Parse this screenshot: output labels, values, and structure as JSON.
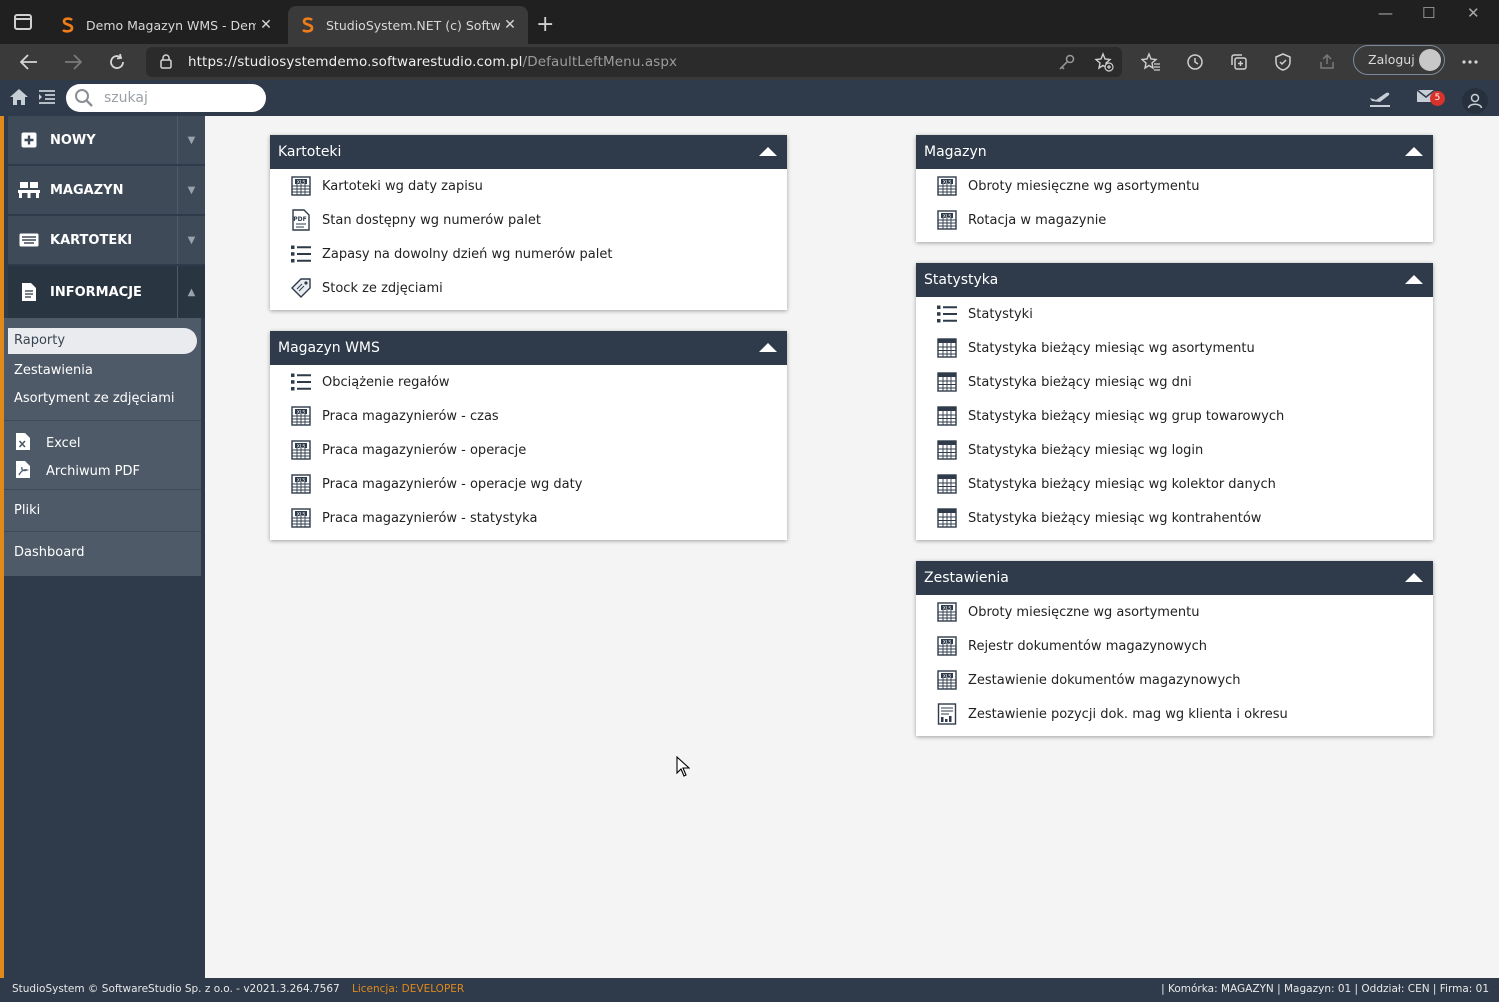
{
  "browser": {
    "tabs": [
      {
        "title": "Demo Magazyn WMS - Demo o"
      },
      {
        "title": "StudioSystem.NET (c) SoftwareSt"
      }
    ],
    "url_host": "https://studiosystemdemo.softwarestudio.com.pl",
    "url_path": "/DefaultLeftMenu.aspx",
    "profile_label": "Zaloguj"
  },
  "app": {
    "search_placeholder": "szukaj",
    "mail_badge": "5"
  },
  "sidebar": {
    "items": [
      {
        "label": "NOWY",
        "icon": "plus-square-icon"
      },
      {
        "label": "MAGAZYN",
        "icon": "pallet-icon"
      },
      {
        "label": "KARTOTEKI",
        "icon": "keyboard-icon"
      },
      {
        "label": "INFORMACJE",
        "icon": "document-icon"
      }
    ],
    "subitems": [
      {
        "label": "Raporty"
      },
      {
        "label": "Zestawienia"
      },
      {
        "label": "Asortyment ze zdjęciami"
      },
      {
        "label": "Excel"
      },
      {
        "label": "Archiwum PDF"
      },
      {
        "label": "Pliki"
      },
      {
        "label": "Dashboard"
      }
    ]
  },
  "panels": {
    "kartoteki": {
      "title": "Kartoteki",
      "rows": [
        {
          "label": "Kartoteki wg daty zapisu",
          "icon": "xls-icon"
        },
        {
          "label": "Stan dostępny wg numerów palet",
          "icon": "pdf-icon"
        },
        {
          "label": "Zapasy na dowolny dzień wg numerów palet",
          "icon": "list-icon"
        },
        {
          "label": "Stock ze zdjęciami",
          "icon": "tag-icon"
        }
      ]
    },
    "magazyn_wms": {
      "title": "Magazyn WMS",
      "rows": [
        {
          "label": "Obciążenie regałów",
          "icon": "list-icon"
        },
        {
          "label": "Praca magazynierów - czas",
          "icon": "xls-icon"
        },
        {
          "label": "Praca magazynierów - operacje",
          "icon": "xls-icon"
        },
        {
          "label": "Praca magazynierów - operacje wg daty",
          "icon": "xls-icon"
        },
        {
          "label": "Praca magazynierów - statystyka",
          "icon": "xls-icon"
        }
      ]
    },
    "magazyn": {
      "title": "Magazyn",
      "rows": [
        {
          "label": "Obroty miesięczne wg asortymentu",
          "icon": "xls-icon"
        },
        {
          "label": "Rotacja w magazynie",
          "icon": "xls-icon"
        }
      ]
    },
    "statystyka": {
      "title": "Statystyka",
      "rows": [
        {
          "label": "Statystyki",
          "icon": "list-icon"
        },
        {
          "label": "Statystyka bieżący miesiąc wg asortymentu",
          "icon": "grid-icon"
        },
        {
          "label": "Statystyka bieżący miesiąc wg dni",
          "icon": "grid-icon"
        },
        {
          "label": "Statystyka bieżący miesiąc wg grup towarowych",
          "icon": "grid-icon"
        },
        {
          "label": "Statystyka bieżący miesiąc wg login",
          "icon": "grid-icon"
        },
        {
          "label": "Statystyka bieżący miesiąc wg kolektor danych",
          "icon": "grid-icon"
        },
        {
          "label": "Statystyka bieżący miesiąc wg kontrahentów",
          "icon": "grid-icon"
        }
      ]
    },
    "zestawienia": {
      "title": "Zestawienia",
      "rows": [
        {
          "label": "Obroty miesięczne wg asortymentu",
          "icon": "xls-icon"
        },
        {
          "label": "Rejestr dokumentów magazynowych",
          "icon": "xls-icon"
        },
        {
          "label": "Zestawienie dokumentów magazynowych",
          "icon": "xls-icon"
        },
        {
          "label": "Zestawienie pozycji dok. mag wg klienta i okresu",
          "icon": "report-icon"
        }
      ]
    }
  },
  "status": {
    "left": "StudioSystem © SoftwareStudio Sp. z o.o. - v2021.3.264.7567",
    "license_label": "Licencja:",
    "license_value": "DEVELOPER",
    "right": "| Komórka: MAGAZYN | Magazyn: 01 | Oddział: CEN | Firma: 01"
  },
  "colors": {
    "header": "#2f3b4a",
    "accent": "#e08a1c",
    "content_bg": "#f4f4f4"
  }
}
